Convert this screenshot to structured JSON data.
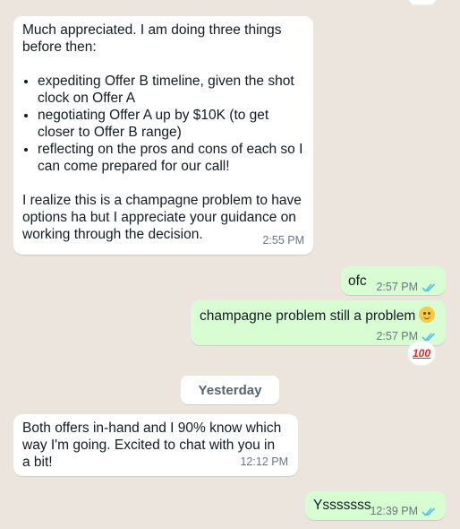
{
  "messages": [
    {
      "direction": "incoming",
      "intro": "Much appreciated. I am doing three things before then:",
      "bullets": [
        "expediting Offer B timeline, given the shot clock on Offer A",
        "negotiating Offer A up by $10K (to get closer to Offer B range)",
        "reflecting on the pros and cons of each so I can come prepared for our call!"
      ],
      "outro": "I realize this is a champagne problem to have options ha but I appreciate your guidance on working through the decision.",
      "time": "2:55 PM"
    },
    {
      "direction": "outgoing",
      "text": "ofc",
      "time": "2:57 PM",
      "status": "read"
    },
    {
      "direction": "outgoing",
      "text": "champagne problem still a problem",
      "emoji": "slightly-smiling-face",
      "time": "2:57 PM",
      "status": "read",
      "reaction": "100"
    },
    {
      "direction": "incoming",
      "text": "Both offers in-hand and I 90% know which way I'm going. Excited to chat with you in a bit!",
      "time": "12:12 PM"
    },
    {
      "direction": "outgoing",
      "text": "Ysssssss",
      "time": "12:39 PM",
      "status": "read"
    }
  ],
  "day_separator": "Yesterday",
  "colors": {
    "background": "#ece5dd",
    "incoming_bubble": "#ffffff",
    "outgoing_bubble": "#d9fdd3",
    "read_ticks": "#53bdeb",
    "timestamp": "#667781"
  }
}
